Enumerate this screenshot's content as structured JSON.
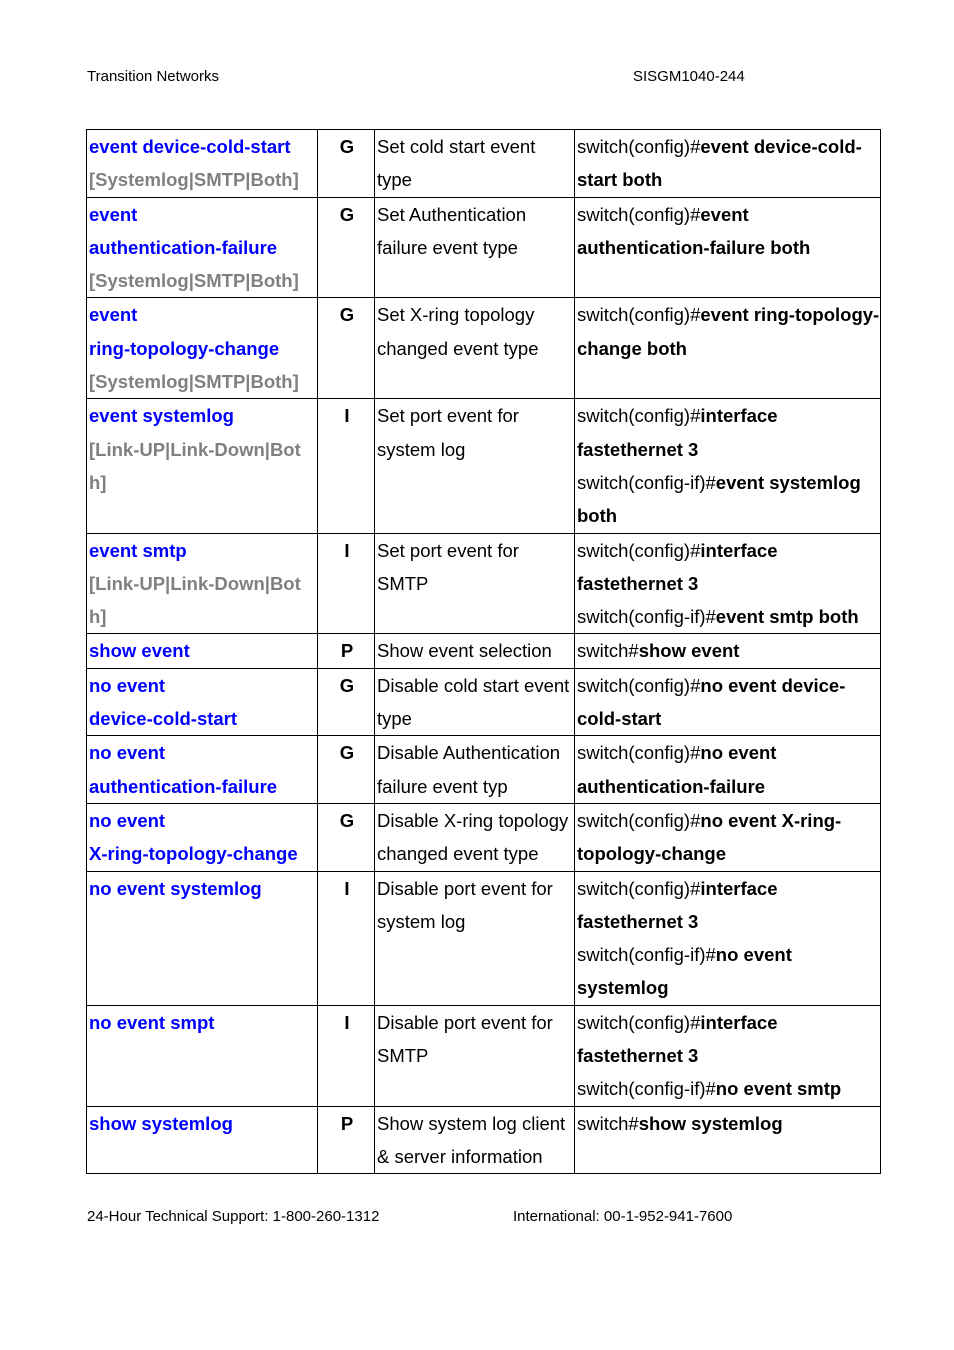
{
  "header": {
    "left": "Transition Networks",
    "right": "SISGM1040-244"
  },
  "rows": [
    {
      "command": [
        "event device-cold-start"
      ],
      "param": "[Systemlog|SMTP|Both]",
      "mode": "G",
      "description": "Set cold start event type",
      "example": [
        {
          "prefix": "switch(config)#",
          "bold": "event device-cold-start both"
        }
      ]
    },
    {
      "command": [
        "event",
        "authentication-failure"
      ],
      "param": "[Systemlog|SMTP|Both]",
      "mode": "G",
      "description": "Set Authentication failure event type",
      "example": [
        {
          "prefix": "switch(config)#",
          "bold": "event authentication-failure both"
        }
      ]
    },
    {
      "command": [
        "event",
        "ring-topology-change"
      ],
      "param": "[Systemlog|SMTP|Both]",
      "mode": "G",
      "description": "Set X-ring topology changed event type",
      "example": [
        {
          "prefix": "switch(config)#",
          "bold": "event ring-topology-change both"
        }
      ]
    },
    {
      "command": [
        "event systemlog"
      ],
      "param": "[Link-UP|Link-Down|Both]",
      "mode": "I",
      "description": "Set port event for system log",
      "example": [
        {
          "prefix": "switch(config)#",
          "bold": "interface fastethernet 3"
        },
        {
          "prefix": "switch(config-if)#",
          "bold": "event systemlog both"
        }
      ]
    },
    {
      "command": [
        "event smtp"
      ],
      "param": "[Link-UP|Link-Down|Both]",
      "mode": "I",
      "description": "Set port event for SMTP",
      "example": [
        {
          "prefix": "switch(config)#",
          "bold": "interface fastethernet 3"
        },
        {
          "prefix": "switch(config-if)#",
          "bold": "event smtp both"
        }
      ]
    },
    {
      "command": [
        "show event"
      ],
      "param": "",
      "mode": "P",
      "description": "Show event selection",
      "example": [
        {
          "prefix": "switch#",
          "bold": "show event"
        }
      ]
    },
    {
      "command": [
        "no event",
        "device-cold-start"
      ],
      "param": "",
      "mode": "G",
      "description": "Disable cold start event type",
      "example": [
        {
          "prefix": "switch(config)#",
          "bold": "no event device-cold-start"
        }
      ]
    },
    {
      "command": [
        "no event",
        "authentication-failure"
      ],
      "param": "",
      "mode": "G",
      "description": "Disable Authentication failure event typ",
      "example": [
        {
          "prefix": "switch(config)#",
          "bold": "no event authentication-failure"
        }
      ]
    },
    {
      "command": [
        "no event",
        "X-ring-topology-change"
      ],
      "param": "",
      "mode": "G",
      "description": "Disable X-ring topology changed event type",
      "example": [
        {
          "prefix": "switch(config)#",
          "bold": "no event X-ring-topology-change"
        }
      ]
    },
    {
      "command": [
        "no event systemlog"
      ],
      "param": "",
      "mode": "I",
      "description": "Disable port event for system log",
      "example": [
        {
          "prefix": "switch(config)#",
          "bold": "interface fastethernet 3"
        },
        {
          "prefix": "switch(config-if)#",
          "bold": "no event systemlog"
        }
      ]
    },
    {
      "command": [
        "no event smpt"
      ],
      "param": "",
      "mode": "I",
      "description": "Disable port event for SMTP",
      "example": [
        {
          "prefix": "switch(config)#",
          "bold": "interface fastethernet 3"
        },
        {
          "prefix": "switch(config-if)#",
          "bold": "no event smtp"
        }
      ]
    },
    {
      "command": [
        "show systemlog"
      ],
      "param": "",
      "mode": "P",
      "description": "Show system log client & server information",
      "example": [
        {
          "prefix": "switch#",
          "bold": "show systemlog"
        }
      ]
    }
  ],
  "footer": {
    "left": "24-Hour Technical Support: 1-800-260-1312",
    "right": "International: 00-1-952-941-7600"
  }
}
